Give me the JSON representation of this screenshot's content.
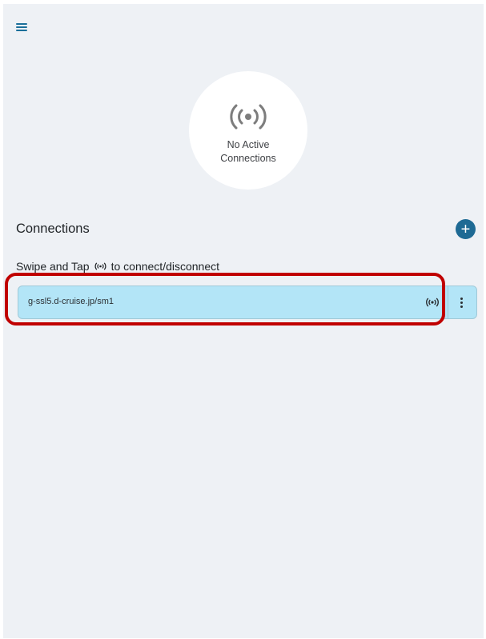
{
  "header": {
    "menu_icon": "hamburger-menu-icon"
  },
  "status": {
    "icon": "broadcast-icon",
    "text": "No Active Connections"
  },
  "connections": {
    "title": "Connections",
    "add_icon": "plus-icon",
    "add_label": "+",
    "hint_prefix": "Swipe and Tap",
    "hint_icon": "broadcast-icon",
    "hint_suffix": "to connect/disconnect",
    "items": [
      {
        "label": "g-ssl5.d-cruise.jp/sm1",
        "connect_icon": "broadcast-icon",
        "menu_icon": "more-vertical-icon"
      }
    ]
  },
  "colors": {
    "background": "#eef1f5",
    "accent": "#1e6a94",
    "row_background": "#b3e5f7",
    "highlight": "#c00000"
  }
}
